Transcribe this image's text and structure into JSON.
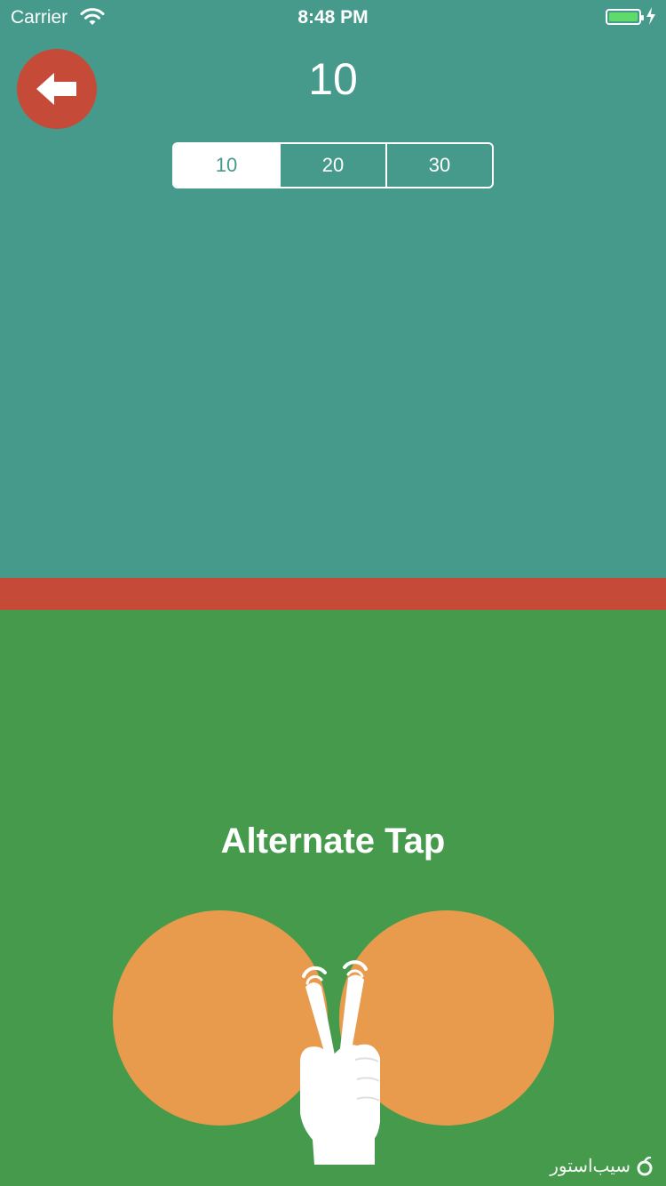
{
  "status_bar": {
    "carrier": "Carrier",
    "time": "8:48 PM",
    "icons": [
      "wifi-icon",
      "battery-icon",
      "charging-icon"
    ]
  },
  "header": {
    "back_icon": "arrow-left-icon",
    "count": "10"
  },
  "segmented_control": {
    "options": [
      "10",
      "20",
      "30"
    ],
    "selected": "10"
  },
  "game": {
    "instruction": "Alternate Tap",
    "illustration_icon": "two-finger-tap-hand-icon"
  },
  "watermark": {
    "text": "سیب‌استور"
  },
  "colors": {
    "top_panel": "#459A8C",
    "divider": "#C64A38",
    "bottom_panel": "#469A4C",
    "tap_circle": "#E89B4C",
    "back_button": "#C64A38"
  }
}
